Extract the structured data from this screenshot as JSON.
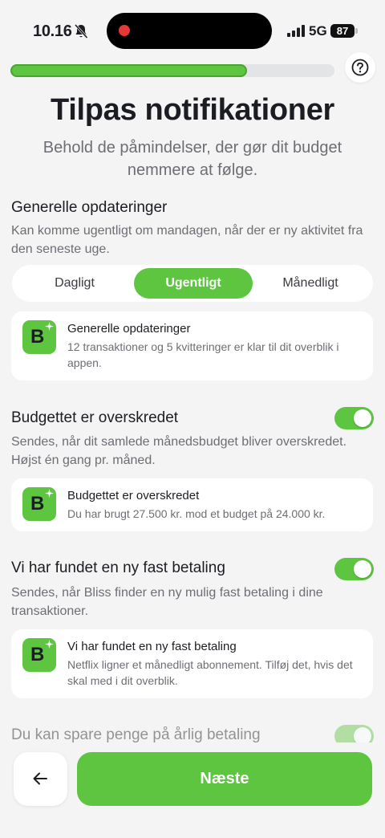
{
  "status_bar": {
    "time": "10.16",
    "network": "5G",
    "battery": "87"
  },
  "onboarding": {
    "progress_fraction": 0.73
  },
  "header": {
    "title": "Tilpas notifikationer",
    "subtitle": "Behold de påmindelser, der gør dit budget nemmere at følge."
  },
  "general": {
    "title": "Generelle opdateringer",
    "description": "Kan komme ugentligt om mandagen, når der er ny aktivitet fra den seneste uge.",
    "frequency_options": [
      "Dagligt",
      "Ugentligt",
      "Månedligt"
    ],
    "selected_index": 1,
    "preview": {
      "title": "Generelle opdateringer",
      "body": "12 transaktioner og 5 kvitteringer er klar til dit overblik i appen."
    }
  },
  "budget": {
    "title": "Budgettet er overskredet",
    "enabled": true,
    "description": "Sendes, når dit samlede månedsbudget bliver overskredet. Højst én gang pr. måned.",
    "preview": {
      "title": "Budgettet er overskredet",
      "body": "Du har brugt 27.500 kr. mod et budget på 24.000 kr."
    }
  },
  "fixed_payment": {
    "title": "Vi har fundet en ny fast betaling",
    "enabled": true,
    "description": "Sendes, når Bliss finder en ny mulig fast betaling i dine transaktioner.",
    "preview": {
      "title": "Vi har fundet en ny fast betaling",
      "body": "Netflix ligner et månedligt abonnement. Tilføj det, hvis det skal med i dit overblik."
    }
  },
  "savings": {
    "title": "Du kan spare penge på årlig betaling",
    "enabled": true
  },
  "app_icon_letter": "B",
  "footer": {
    "next_label": "Næste"
  },
  "colors": {
    "accent": "#5ec541",
    "background": "#f4f4f5",
    "card": "#ffffff",
    "text": "#1c1d22",
    "muted": "#6d6e74"
  }
}
